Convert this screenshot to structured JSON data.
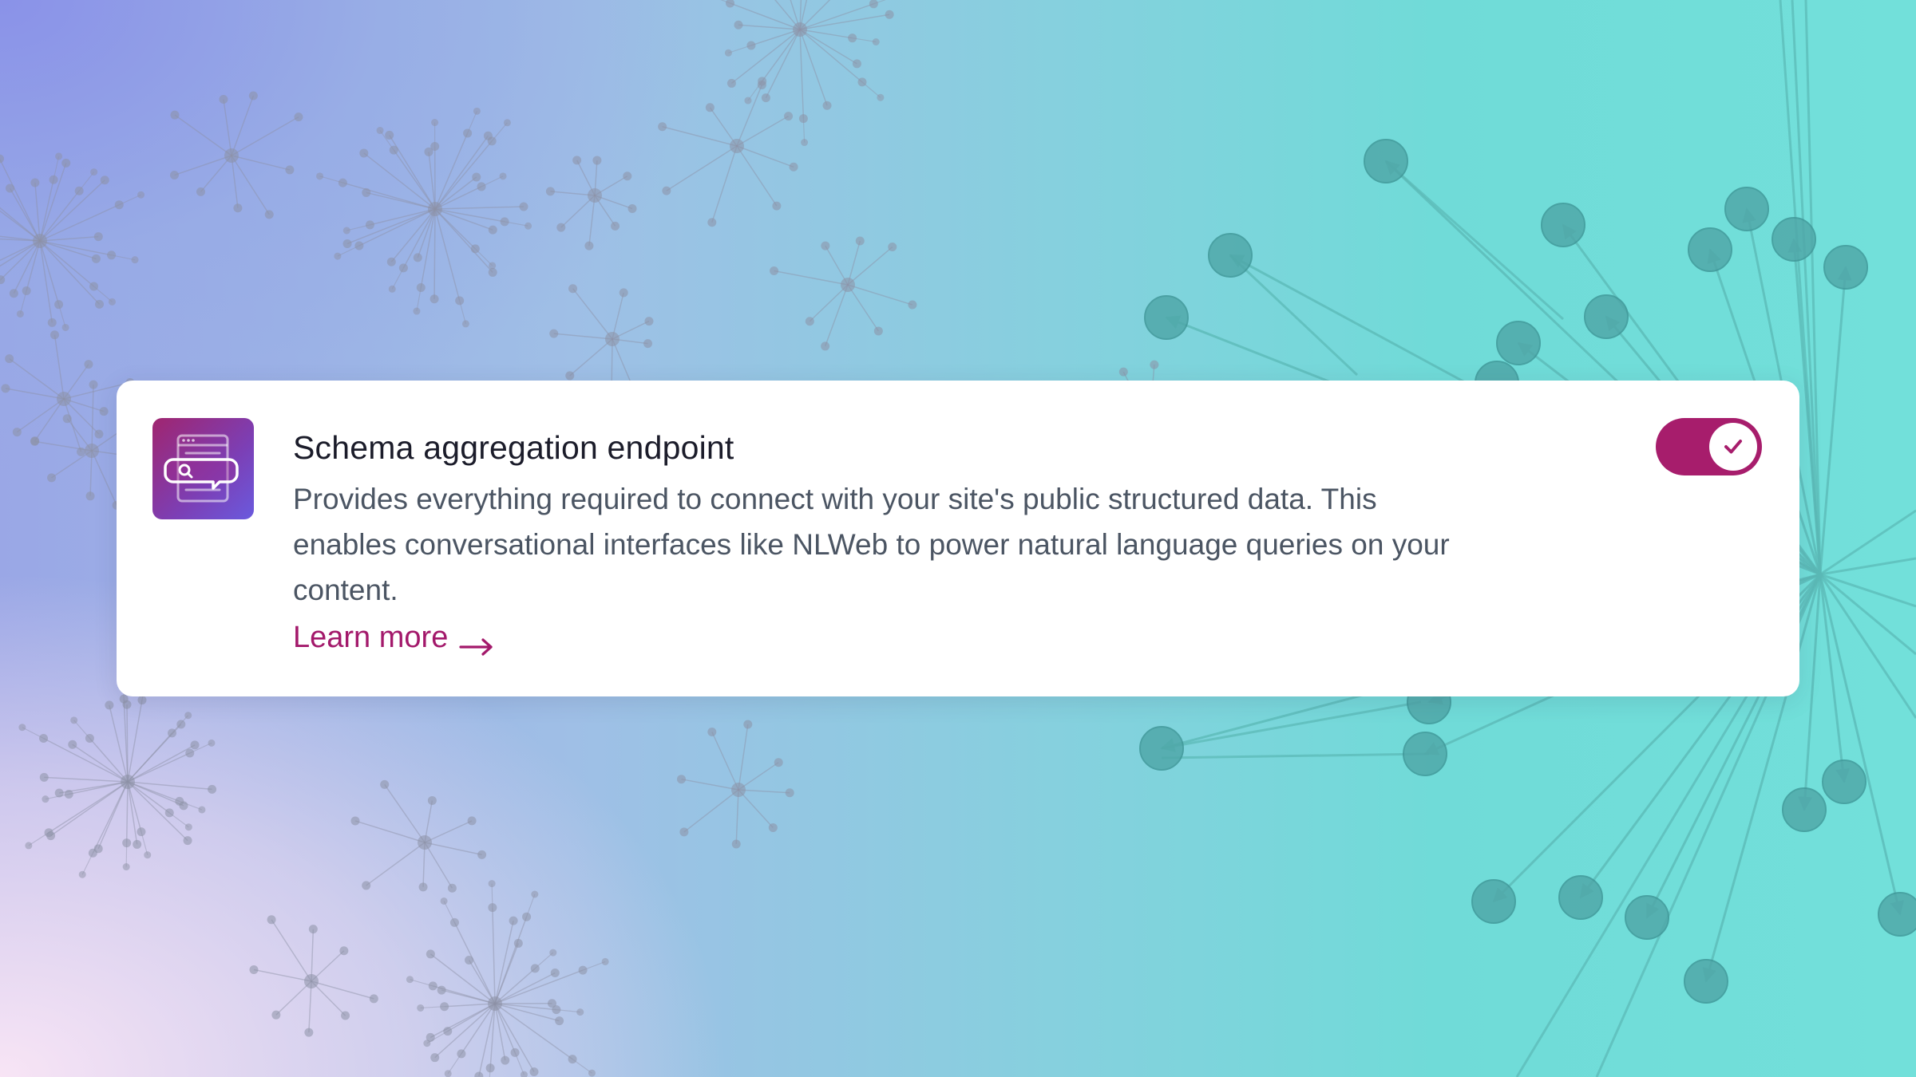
{
  "feature": {
    "icon": "schema-search-chat-icon",
    "title": "Schema aggregation endpoint",
    "description": "Provides everything required to connect with your site's public structured data. This enables conversational interfaces like NLWeb to power natural language queries on your content.",
    "learn_more_label": "Learn more",
    "learn_more_icon": "arrow-right-icon",
    "toggle": {
      "state": "on",
      "icon": "check-icon"
    }
  },
  "colors": {
    "accent": "#a71d6c",
    "link": "#a3196b",
    "icon_gradient_start": "#a0256f",
    "icon_gradient_end": "#6a5ade"
  }
}
